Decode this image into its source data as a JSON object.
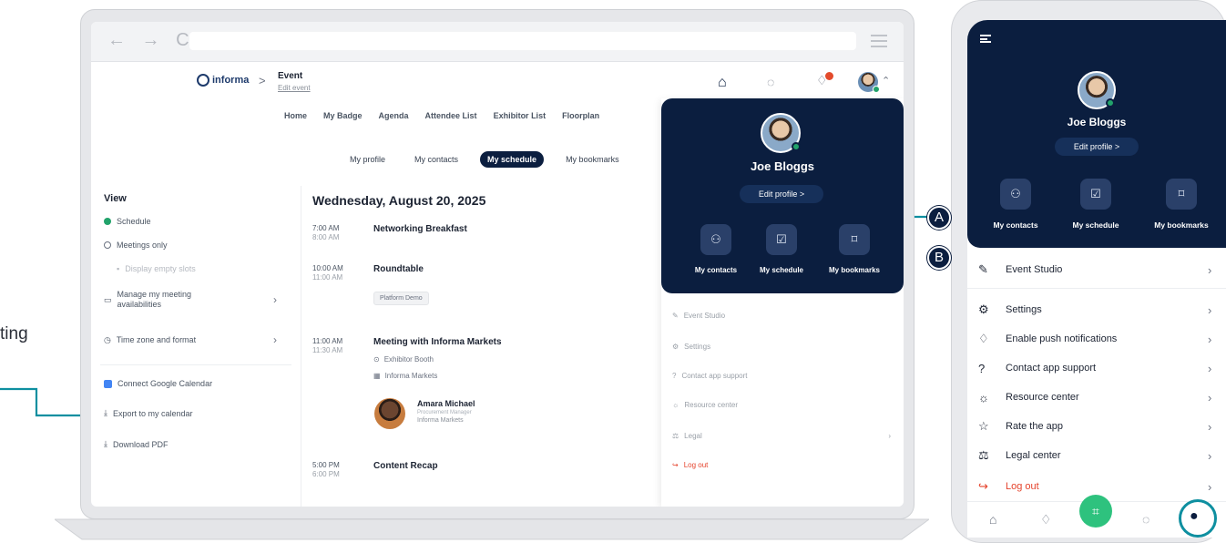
{
  "annotation": {
    "partial_text": "ting"
  },
  "browser": {
    "nav_arrows": "← → C"
  },
  "header": {
    "logo_text": "informa",
    "breadcrumb_sep": ">",
    "event_title": "Event",
    "event_sub": "Edit event",
    "icons": {
      "home": "home-icon",
      "chat": "chat-icon",
      "bell": "bell-icon",
      "avatar_chevron": "chevron-up-icon"
    }
  },
  "main_nav": [
    "Home",
    "My Badge",
    "Agenda",
    "Attendee List",
    "Exhibitor List",
    "Floorplan"
  ],
  "sub_tabs": [
    {
      "label": "My profile",
      "active": false
    },
    {
      "label": "My contacts",
      "active": false
    },
    {
      "label": "My schedule",
      "active": true
    },
    {
      "label": "My bookmarks",
      "active": false
    }
  ],
  "sidebar": {
    "view_label": "View",
    "schedule": "Schedule",
    "meetings_only": "Meetings only",
    "display_empty": "Display empty slots",
    "manage_avail": "Manage my meeting availabilities",
    "timezone": "Time zone and format",
    "connect_google": "Connect Google Calendar",
    "export_calendar": "Export to my calendar",
    "download_pdf": "Download PDF"
  },
  "schedule": {
    "date": "Wednesday, August 20, 2025",
    "events": [
      {
        "start": "7:00 AM",
        "end": "8:00 AM",
        "title": "Networking Breakfast"
      },
      {
        "start": "10:00 AM",
        "end": "11:00 AM",
        "title": "Roundtable",
        "tag": "Platform Demo"
      },
      {
        "start": "11:00 AM",
        "end": "11:30 AM",
        "title": "Meeting with Informa Markets",
        "location": "Exhibitor Booth",
        "company": "Informa Markets",
        "person": {
          "name": "Amara Michael",
          "role": "Procurement Manager",
          "company": "Informa Markets"
        }
      },
      {
        "start": "5:00 PM",
        "end": "6:00 PM",
        "title": "Content Recap"
      }
    ]
  },
  "dropdown": {
    "name": "Joe Bloggs",
    "edit_profile": "Edit profile  >",
    "tiles": [
      "My contacts",
      "My schedule",
      "My bookmarks"
    ],
    "menu": [
      "Event Studio",
      "Settings",
      "Contact app support",
      "Resource center",
      "Legal",
      "Log out"
    ]
  },
  "callouts": {
    "a": "A",
    "b": "B"
  },
  "phone": {
    "name": "Joe Bloggs",
    "edit_profile": "Edit profile  >",
    "tiles": [
      "My contacts",
      "My schedule",
      "My bookmarks"
    ],
    "menu": [
      "Event Studio",
      "Settings",
      "Enable push notifications",
      "Contact app support",
      "Resource center",
      "Rate the app",
      "Legal center",
      "Log out"
    ]
  },
  "colors": {
    "navy": "#0b1e3f",
    "teal_callout": "#0e8fa0",
    "green": "#22a36b",
    "logout_red": "#e5432c"
  }
}
